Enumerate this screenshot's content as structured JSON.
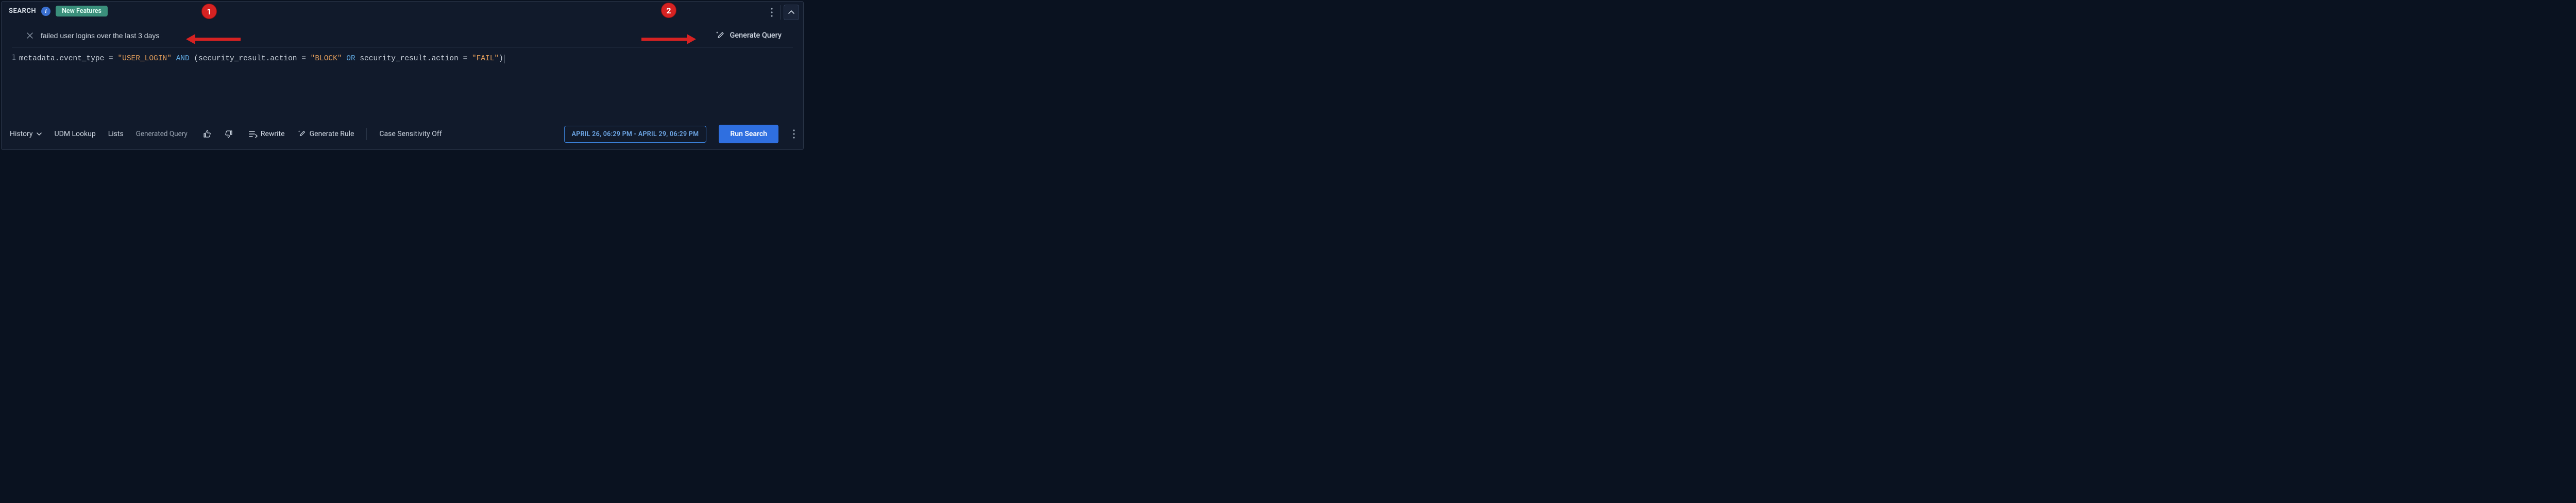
{
  "header": {
    "search_label": "SEARCH",
    "info_char": "i",
    "new_features_label": "New Features"
  },
  "annotations": {
    "badge_1": "1",
    "badge_2": "2"
  },
  "nl": {
    "query_text": "failed user logins over the last 3 days",
    "generate_label": "Generate Query"
  },
  "editor": {
    "line_number": "1",
    "tokens": {
      "t1": "metadata.event_type = ",
      "s1": "\"USER_LOGIN\"",
      "sp1": " ",
      "k1": "AND",
      "t2": " (security_result.action = ",
      "s2": "\"BLOCK\"",
      "sp2": " ",
      "k2": "OR",
      "t3": " security_result.action = ",
      "s3": "\"FAIL\"",
      "t4": ")"
    }
  },
  "footer": {
    "history_label": "History",
    "udm_label": "UDM Lookup",
    "lists_label": "Lists",
    "generated_query_label": "Generated Query",
    "rewrite_label": "Rewrite",
    "generate_rule_label": "Generate Rule",
    "case_label": "Case Sensitivity Off",
    "time_range_label": "APRIL 26, 06:29 PM - APRIL 29, 06:29 PM",
    "run_label": "Run Search"
  }
}
